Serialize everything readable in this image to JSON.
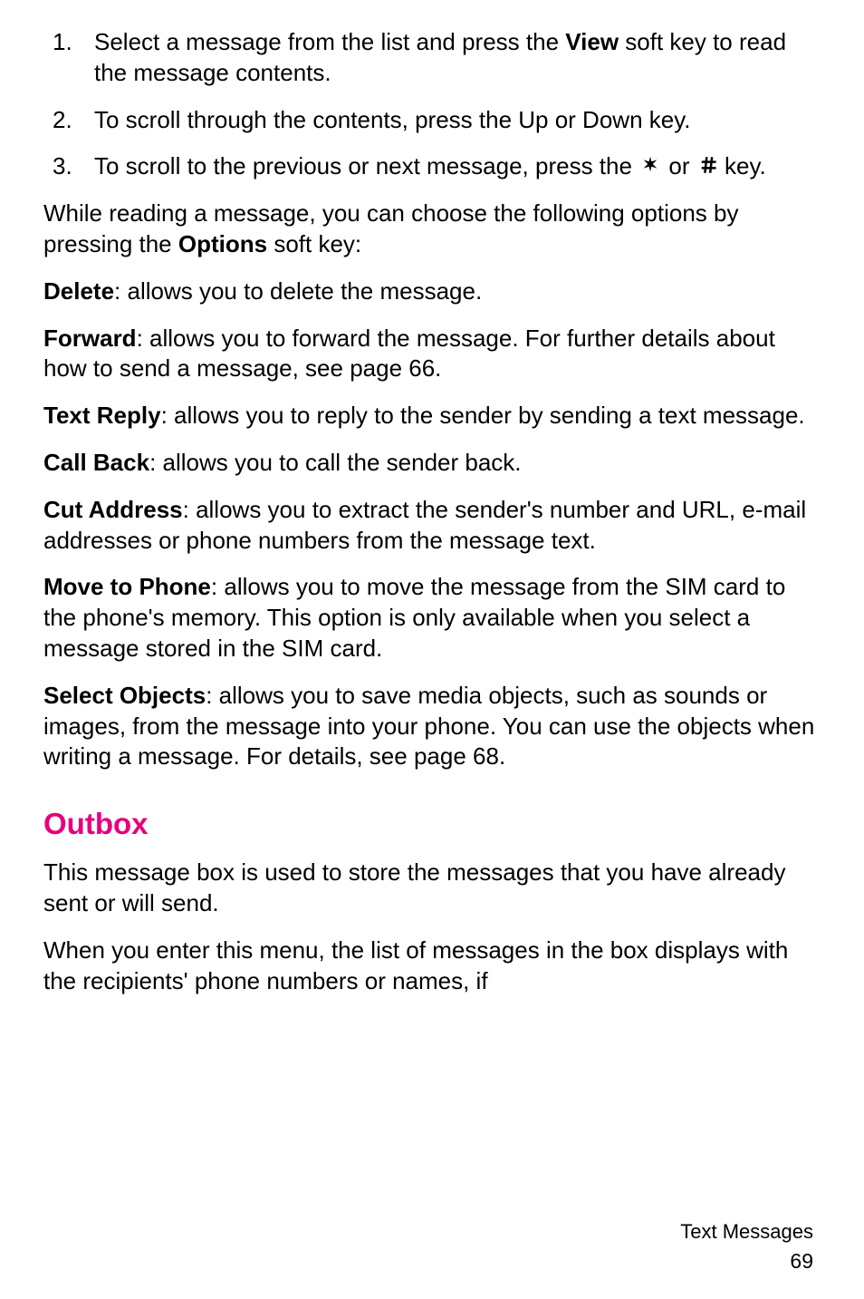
{
  "steps": [
    {
      "num": "1.",
      "pre": "Select a message from the list and press the ",
      "bold": "View",
      "post": " soft key to read the message contents."
    },
    {
      "num": "2.",
      "text": "To scroll through the contents, press the Up or Down key."
    },
    {
      "num": "3.",
      "pre": "To scroll to the previous or next message, press the ",
      "mid": " or ",
      "post": " key."
    }
  ],
  "options_intro": {
    "pre": "While reading a message, you can choose the following options by pressing the ",
    "bold": "Options",
    "post": " soft key:"
  },
  "entries": [
    {
      "term": "Delete",
      "desc": ": allows you to delete the message."
    },
    {
      "term": "Forward",
      "desc": ": allows you to forward the message. For further details about how to send a message, see page 66."
    },
    {
      "term": "Text Reply",
      "desc": ": allows you to reply to the sender by sending a text message."
    },
    {
      "term": "Call Back",
      "desc": ": allows you to call the sender back."
    },
    {
      "term": "Cut Address",
      "desc": ": allows you to extract the sender's number and URL, e-mail addresses or phone numbers from the message text."
    },
    {
      "term": "Move to Phone",
      "desc": ": allows you to move the message from the SIM card to the phone's memory. This option is only available when you select a message stored in the SIM card."
    },
    {
      "term": "Select Objects",
      "desc": ": allows you to save media objects, such as sounds or images, from the message into your phone. You can use the objects when writing a message. For details, see page 68."
    }
  ],
  "outbox": {
    "heading": "Outbox",
    "p1": "This message box is used to store the messages that you have already sent or will send.",
    "p2": "When you enter this menu, the list of messages in the box displays with the recipients' phone numbers or names, if"
  },
  "footer": {
    "section": "Text Messages",
    "page": "69"
  }
}
